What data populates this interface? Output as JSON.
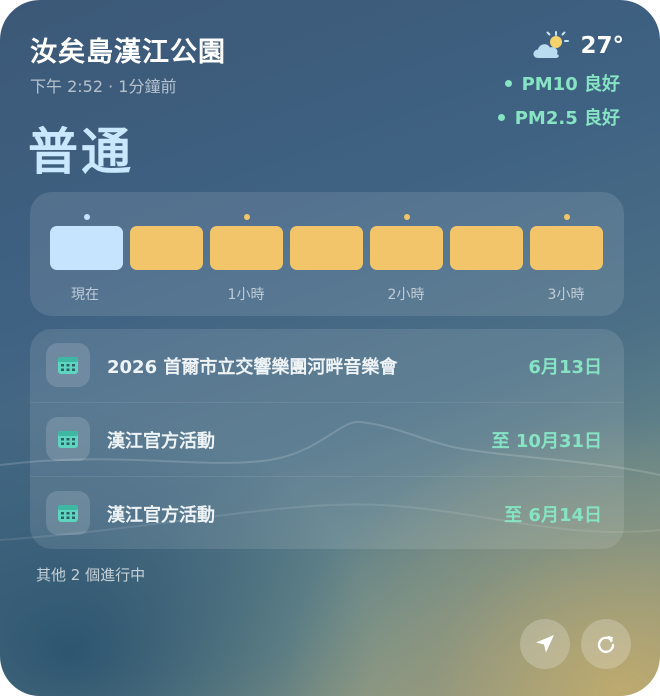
{
  "header": {
    "title": "汝矣島漢江公園",
    "subtitle": "下午 2:52 · 1分鐘前",
    "aqi_status": "普通"
  },
  "weather": {
    "icon": "partly-sunny-icon",
    "temperature": "27°"
  },
  "pollutants": [
    {
      "label": "PM10 良好",
      "color": "#86e3c3"
    },
    {
      "label": "PM2.5 良好",
      "color": "#86e3c3"
    }
  ],
  "forecast": {
    "segments": [
      {
        "level": "now",
        "color": "#c7e4ff"
      },
      {
        "level": "moderate",
        "color": "#f3c56a"
      },
      {
        "level": "moderate",
        "color": "#f3c56a"
      },
      {
        "level": "moderate",
        "color": "#f3c56a"
      },
      {
        "level": "moderate",
        "color": "#f3c56a"
      },
      {
        "level": "moderate",
        "color": "#f3c56a"
      },
      {
        "level": "moderate",
        "color": "#f3c56a"
      }
    ],
    "ticks": [
      "現在",
      "1小時",
      "2小時",
      "3小時"
    ]
  },
  "events": [
    {
      "title": "2026 首爾市立交響樂團河畔音樂會",
      "date": "6月13日",
      "icon": "calendar-icon"
    },
    {
      "title": "漢江官方活動",
      "date": "至 10月31日",
      "icon": "calendar-icon"
    },
    {
      "title": "漢江官方活動",
      "date": "至 6月14日",
      "icon": "calendar-icon"
    }
  ],
  "more_text": "其他 2 個進行中",
  "buttons": {
    "location_icon": "location-arrow-icon",
    "refresh_icon": "refresh-icon"
  },
  "colors": {
    "accent_green": "#86e3c3",
    "aqi_text": "#c9e8ff",
    "moderate": "#f3c56a",
    "now": "#c7e4ff"
  }
}
